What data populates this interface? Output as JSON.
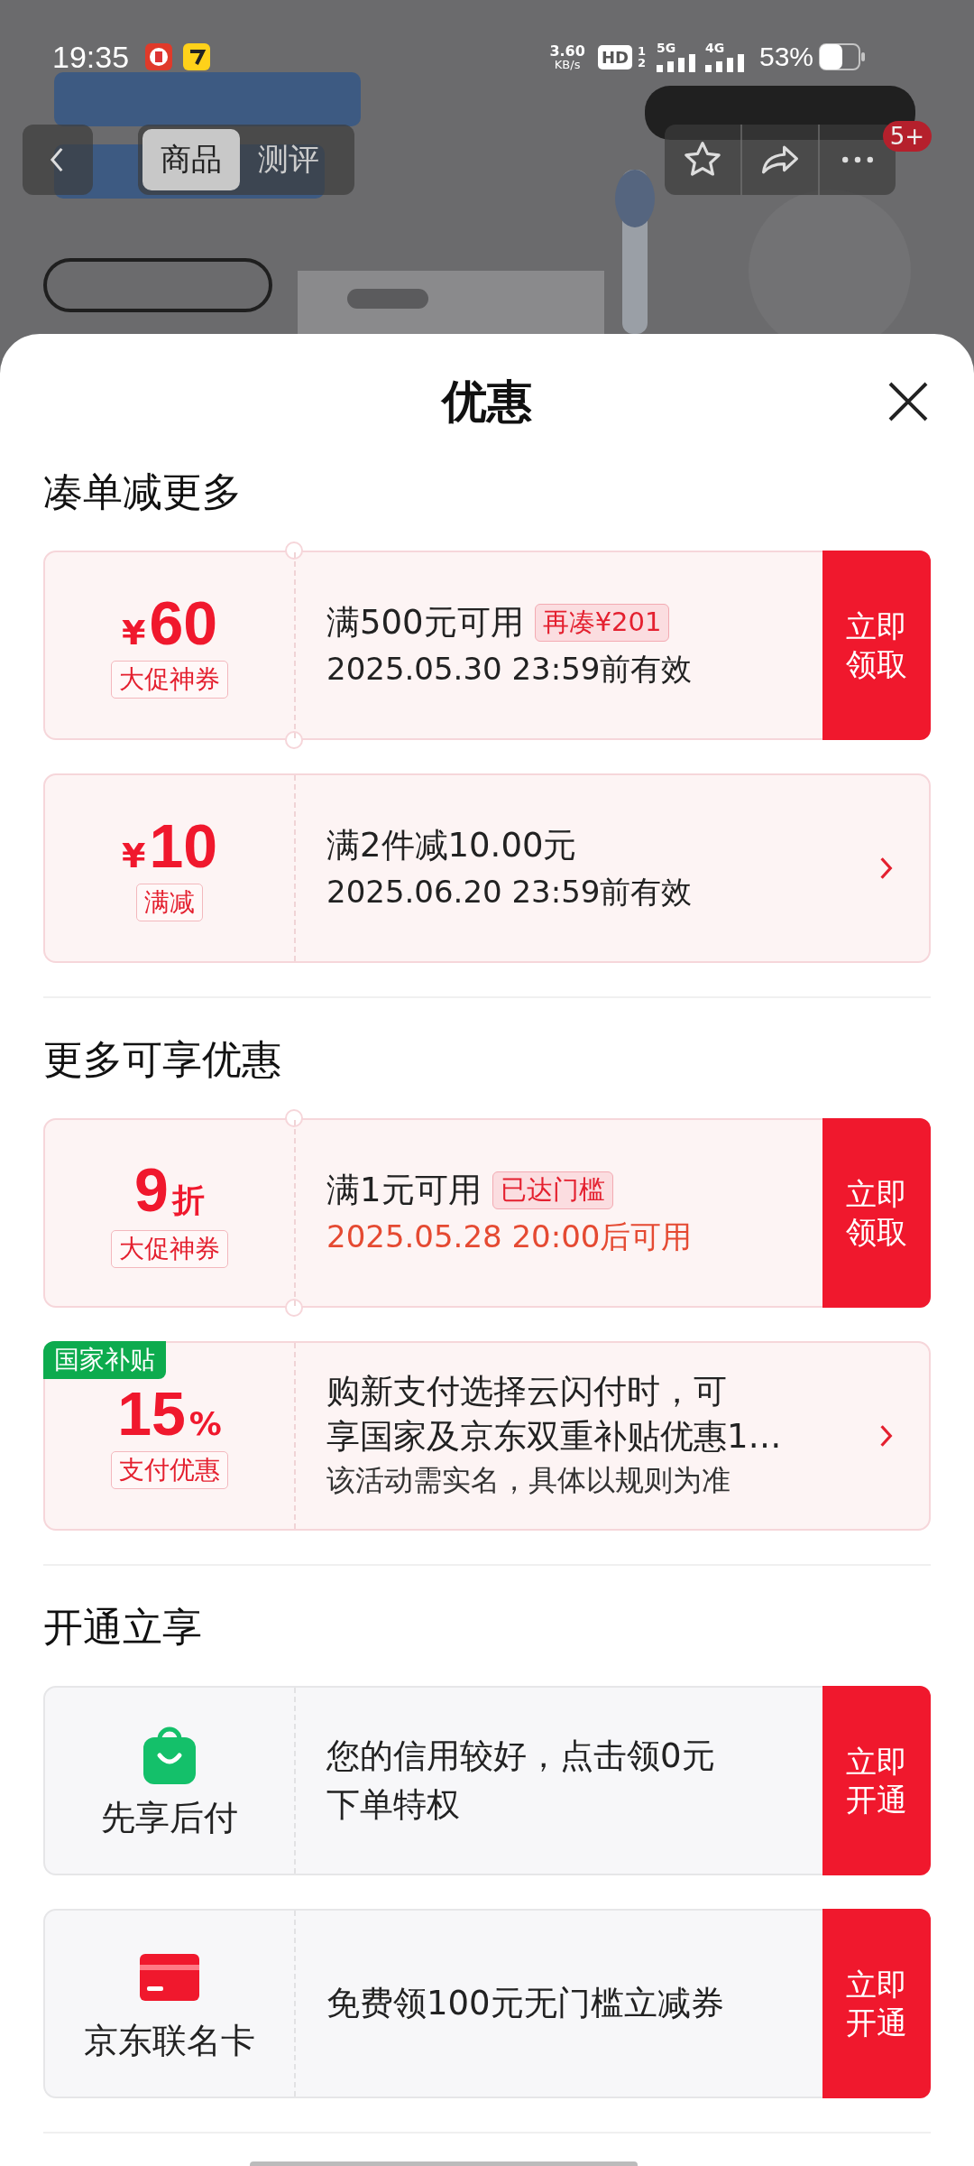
{
  "status_bar": {
    "time": "19:35",
    "speed": "3.60",
    "speed_unit": "KB/s",
    "hd": "HD",
    "hd_sims": [
      "1",
      "2"
    ],
    "networks": [
      "5G",
      "4G"
    ],
    "battery": "53%"
  },
  "nav": {
    "tabs": [
      {
        "label": "商品",
        "selected": true
      },
      {
        "label": "测评",
        "selected": false
      }
    ],
    "badge": "5+"
  },
  "sheet": {
    "title": "优惠",
    "sections": [
      {
        "title": "凑单减更多",
        "offers": [
          {
            "kind": "coupon",
            "currency": "¥",
            "amount": "60",
            "tag": "大促神券",
            "notched": true,
            "condition": "满500元可用",
            "chip": "再凑¥201",
            "validity": "2025.05.30 23:59前有效",
            "validity_highlight": false,
            "action": {
              "kind": "button",
              "label": "立即领取"
            }
          },
          {
            "kind": "coupon",
            "currency": "¥",
            "amount": "10",
            "tag": "满减",
            "notched": false,
            "condition": "满2件减10.00元",
            "validity": "2025.06.20 23:59前有效",
            "validity_highlight": false,
            "action": {
              "kind": "arrow"
            }
          }
        ]
      },
      {
        "title": "更多可享优惠",
        "offers": [
          {
            "kind": "coupon",
            "amount": "9",
            "unit": "折",
            "tag": "大促神券",
            "notched": true,
            "condition": "满1元可用",
            "chip": "已达门槛",
            "validity": "2025.05.28 20:00后可用",
            "validity_highlight": true,
            "action": {
              "kind": "button",
              "label": "立即领取"
            }
          },
          {
            "kind": "coupon",
            "corner_tag": "国家补贴",
            "amount": "15",
            "unit": "%",
            "tag": "支付优惠",
            "notched": false,
            "condition_lines": [
              "购新支付选择云闪付时，可",
              "享国家及京东双重补贴优惠1…"
            ],
            "note": "该活动需实名，具体以规则为准",
            "action": {
              "kind": "arrow"
            }
          }
        ]
      },
      {
        "title": "开通立享",
        "offers": [
          {
            "kind": "service",
            "label": "先享后付",
            "description_lines": [
              "您的信用较好，点击领0元",
              "下单特权"
            ],
            "action": {
              "kind": "button",
              "label": "立即开通"
            }
          },
          {
            "kind": "service",
            "label": "京东联名卡",
            "description_lines": [
              "免费领100元无门槛立减券"
            ],
            "action": {
              "kind": "button",
              "label": "立即开通"
            }
          }
        ]
      }
    ]
  }
}
